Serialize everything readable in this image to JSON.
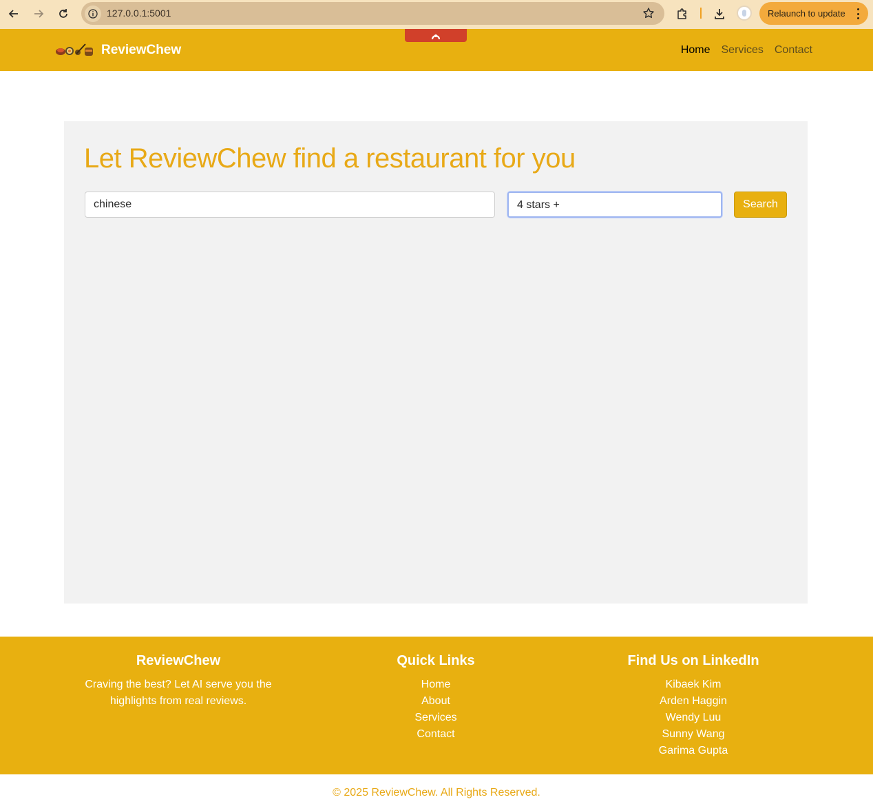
{
  "browser": {
    "url": "127.0.0.1:5001",
    "relaunch_label": "Relaunch to update"
  },
  "navbar": {
    "brand": "ReviewChew",
    "links": [
      {
        "label": "Home",
        "active": true
      },
      {
        "label": "Services",
        "active": false
      },
      {
        "label": "Contact",
        "active": false
      }
    ]
  },
  "main": {
    "headline": "Let ReviewChew find a restaurant for you",
    "query_value": "chinese",
    "rating_value": "4 stars +",
    "search_label": "Search"
  },
  "footer": {
    "about": {
      "title": "ReviewChew",
      "text": "Craving the best? Let AI serve you the highlights from real reviews."
    },
    "quick_links": {
      "title": "Quick Links",
      "items": [
        "Home",
        "About",
        "Services",
        "Contact"
      ]
    },
    "linkedin": {
      "title": "Find Us on LinkedIn",
      "items": [
        "Kibaek Kim",
        "Arden Haggin",
        "Wendy Luu",
        "Sunny Wang",
        "Garima Gupta"
      ]
    },
    "copyright": "© 2025 ReviewChew. All Rights Reserved."
  },
  "colors": {
    "brand_yellow": "#e8b010",
    "headline_gold": "#e8a917",
    "panel_gray": "#f2f2f2",
    "chrome_tan": "#f7e3be",
    "relaunch_orange": "#f3aa3c"
  },
  "icons": [
    "back-arrow-icon",
    "forward-arrow-icon",
    "reload-icon",
    "info-icon",
    "bookmark-star-icon",
    "extensions-icon",
    "download-icon",
    "menu-dots-icon",
    "food-logo-icon",
    "extension-cap-icon"
  ]
}
